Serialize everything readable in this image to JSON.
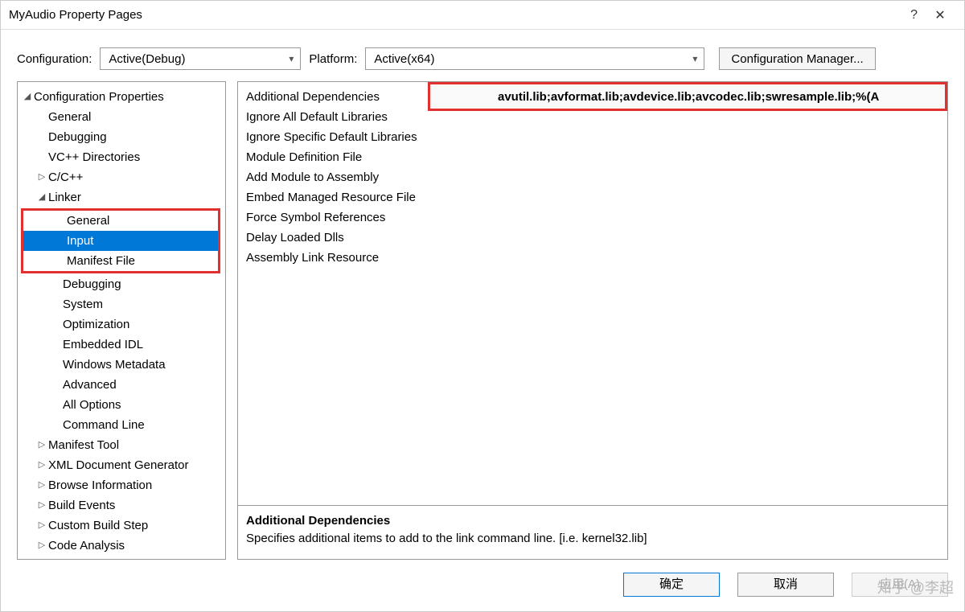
{
  "window": {
    "title": "MyAudio Property Pages",
    "help_icon": "?",
    "close_icon": "✕"
  },
  "toolbar": {
    "config_label": "Configuration:",
    "config_value": "Active(Debug)",
    "platform_label": "Platform:",
    "platform_value": "Active(x64)",
    "manager_label": "Configuration Manager..."
  },
  "tree": {
    "root": "Configuration Properties",
    "items_general": "General",
    "items_debugging": "Debugging",
    "items_vcpp": "VC++ Directories",
    "items_ccpp": "C/C++",
    "items_linker": "Linker",
    "linker_general": "General",
    "linker_input": "Input",
    "linker_manifest": "Manifest File",
    "linker_debugging": "Debugging",
    "linker_system": "System",
    "linker_optimization": "Optimization",
    "linker_embeddedidl": "Embedded IDL",
    "linker_winmeta": "Windows Metadata",
    "linker_advanced": "Advanced",
    "linker_alloptions": "All Options",
    "linker_cmdline": "Command Line",
    "items_manifesttool": "Manifest Tool",
    "items_xdg": "XML Document Generator",
    "items_browseinfo": "Browse Information",
    "items_buildevents": "Build Events",
    "items_custombuild": "Custom Build Step",
    "items_codeanalysis": "Code Analysis"
  },
  "grid": {
    "rows": {
      "additional_deps": "Additional Dependencies",
      "ignore_all": "Ignore All Default Libraries",
      "ignore_specific": "Ignore Specific Default Libraries",
      "module_def": "Module Definition File",
      "add_module": "Add Module to Assembly",
      "embed_managed": "Embed Managed Resource File",
      "force_symbol": "Force Symbol References",
      "delay_loaded": "Delay Loaded Dlls",
      "assembly_link": "Assembly Link Resource"
    },
    "additional_deps_value": "avutil.lib;avformat.lib;avdevice.lib;avcodec.lib;swresample.lib;%(A"
  },
  "desc": {
    "title": "Additional Dependencies",
    "text": "Specifies additional items to add to the link command line. [i.e. kernel32.lib]"
  },
  "footer": {
    "ok": "确定",
    "cancel": "取消",
    "apply": "应用(A)"
  },
  "watermark": "知乎 @李超"
}
